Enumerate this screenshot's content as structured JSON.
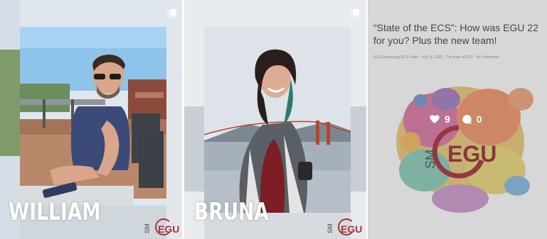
{
  "posts": [
    {
      "name": "WILLIAM",
      "icon": "multiple-images-icon",
      "logo_text": "EGU",
      "logo_prefix": "SM"
    },
    {
      "name": "BRUNA",
      "icon": "multiple-images-icon",
      "logo_text": "EGU",
      "logo_prefix": "SM"
    },
    {
      "title": "“State of the ECS”: How was EGU 22 for you? Plus the new team!",
      "meta": "EGU Seismology ECS Team  ·  July 15, 2022  ·  The state of ECS  ·  No Comments",
      "likes": "9",
      "comments": "0",
      "icon": "multiple-images-icon",
      "logo_text": "EGU",
      "logo_prefix": "SM"
    }
  ]
}
